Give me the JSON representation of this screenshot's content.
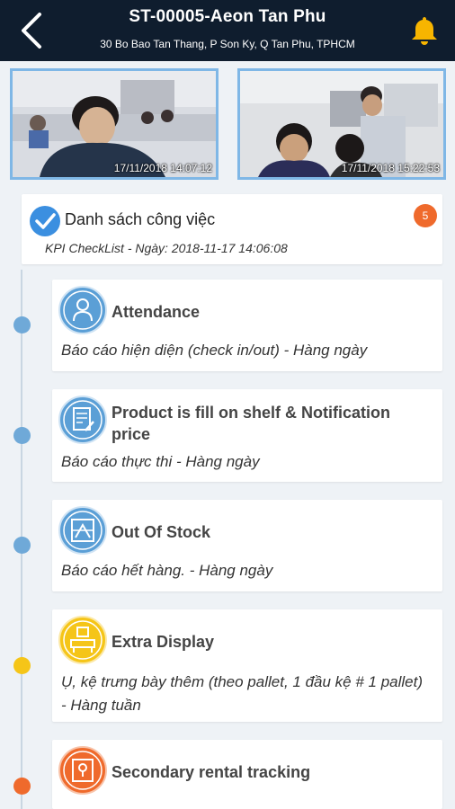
{
  "header": {
    "title": "ST-00005-Aeon Tan Phu",
    "address": "30 Bo Bao Tan Thang, P Son Ky, Q Tan Phu, TPHCM"
  },
  "photos": [
    {
      "timestamp": "17/11/2018 14:07:12"
    },
    {
      "timestamp": "17/11/2018 15:22:53"
    }
  ],
  "work_list": {
    "title": "Danh sách công việc",
    "subtitle": "KPI CheckList - Ngày: 2018-11-17 14:06:08",
    "count": "5"
  },
  "tasks": [
    {
      "title": "Attendance",
      "desc": "Báo cáo hiện diện (check in/out) - Hàng ngày",
      "color": "#5b9fd6",
      "icon": "user-icon"
    },
    {
      "title": "Product is fill on shelf & Notification price",
      "desc": "Báo cáo thực thi - Hàng ngày",
      "color": "#5b9fd6",
      "icon": "document-edit-icon"
    },
    {
      "title": "Out Of Stock",
      "desc": "Báo cáo hết hàng. - Hàng ngày",
      "color": "#5b9fd6",
      "icon": "shelf-icon"
    },
    {
      "title": "Extra Display",
      "desc": "Ụ, kệ trưng bày thêm (theo pallet, 1 đầu kệ # 1 pallet) - Hàng tuần",
      "color": "#f5c518",
      "icon": "display-stand-icon"
    },
    {
      "title": "Secondary rental tracking",
      "desc": "",
      "color": "#ef6a2c",
      "icon": "rental-tracking-icon"
    }
  ]
}
